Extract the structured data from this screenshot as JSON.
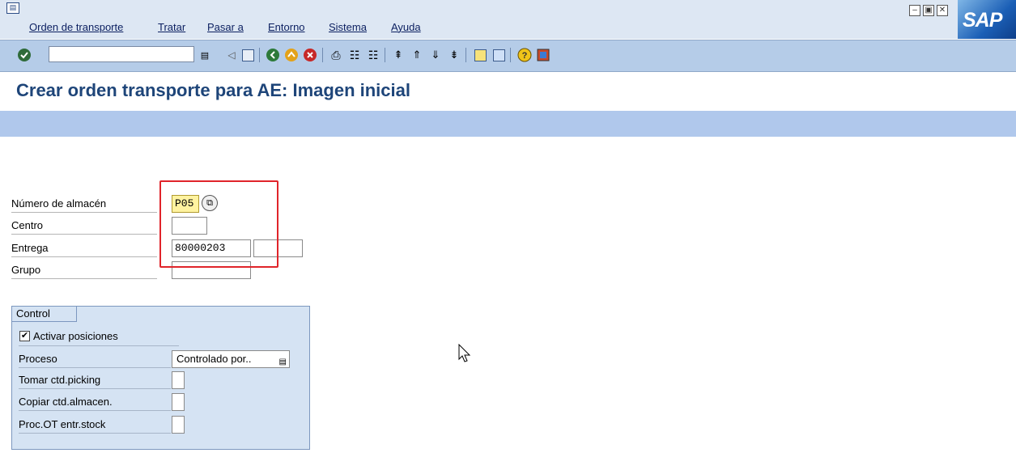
{
  "menu": {
    "items": [
      "Orden de transporte",
      "Tratar",
      "Pasar a",
      "Entorno",
      "Sistema",
      "Ayuda"
    ],
    "system_icon": "menu-toggle-icon",
    "logo_text": "SAP"
  },
  "toolbar": {
    "command_value": "",
    "icons": [
      "confirm-icon",
      "dropdown-icon",
      "back-arrow-icon",
      "save-icon",
      "back-icon",
      "exit-icon",
      "cancel-icon",
      "print-icon",
      "find-icon",
      "find-next-icon",
      "first-page-icon",
      "previous-page-icon",
      "next-page-icon",
      "last-page-icon",
      "create-session-icon",
      "shortcut-icon",
      "help-icon",
      "layout-icon"
    ]
  },
  "title": "Crear orden transporte para AE: Imagen inicial",
  "form": {
    "almacen_label": "Número de almacén",
    "almacen_value": "P05",
    "centro_label": "Centro",
    "centro_value": "",
    "entrega_label": "Entrega",
    "entrega_value": "80000203",
    "entrega_value2": "",
    "grupo_label": "Grupo",
    "grupo_value": ""
  },
  "control": {
    "tab_label": "Control",
    "activar_label": "Activar posiciones",
    "activar_checked": true,
    "proceso_label": "Proceso",
    "proceso_value": "Controlado por..",
    "tomar_label": "Tomar ctd.picking",
    "copiar_label": "Copiar ctd.almacen.",
    "proc_label": "Proc.OT entr.stock"
  },
  "colors": {
    "title": "#1e4579",
    "toolbar": "#b5cce8",
    "highlight": "#e0242a",
    "required_field": "#fff3a0"
  }
}
